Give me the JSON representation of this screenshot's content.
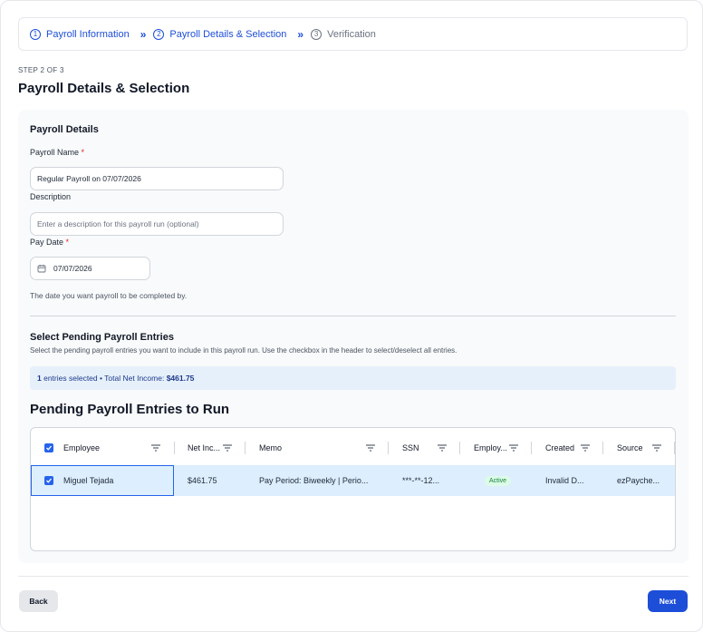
{
  "stepper": {
    "steps": [
      {
        "num": "1",
        "label": "Payroll Information"
      },
      {
        "num": "2",
        "label": "Payroll Details & Selection"
      },
      {
        "num": "3",
        "label": "Verification"
      }
    ],
    "separator": "»"
  },
  "header": {
    "step_of": "STEP 2 OF 3",
    "title": "Payroll Details & Selection"
  },
  "details": {
    "section_title": "Payroll Details",
    "name_label": "Payroll Name",
    "name_value": "Regular Payroll on 07/07/2026",
    "description_label": "Description",
    "description_placeholder": "Enter a description for this payroll run (optional)",
    "pay_date_label": "Pay Date",
    "pay_date_value": "07/07/2026",
    "pay_date_hint": "The date you want payroll to be completed by.",
    "required_mark": "*"
  },
  "selection": {
    "title": "Select Pending Payroll Entries",
    "description": "Select the pending payroll entries you want to include in this payroll run. Use the checkbox in the header to select/deselect all entries.",
    "info_count": "1",
    "info_text": " entries selected • Total Net Income: ",
    "info_total": "$461.75",
    "table_title": "Pending Payroll Entries to Run"
  },
  "table": {
    "columns": [
      "Employee",
      "Net Inc...",
      "Memo",
      "SSN",
      "Employ...",
      "Created",
      "Source"
    ],
    "rows": [
      {
        "employee": "Miguel Tejada",
        "net_income": "$461.75",
        "memo": "Pay Period: Biweekly | Perio...",
        "ssn": "***-**-12...",
        "employment": "Active",
        "created": "Invalid D...",
        "source": "ezPayche..."
      }
    ]
  },
  "footer": {
    "back_label": "Back",
    "next_label": "Next"
  },
  "colors": {
    "accent": "#1d4ed8",
    "selected_row": "#ddeefe",
    "active_badge": "#15803d"
  }
}
